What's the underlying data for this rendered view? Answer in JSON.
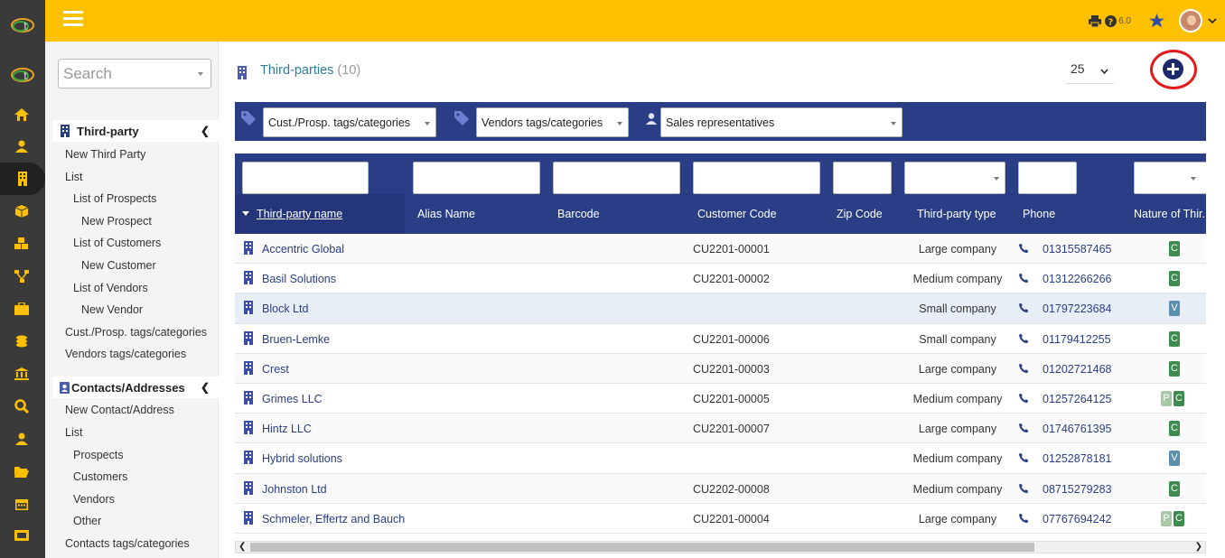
{
  "app": {
    "version": "6.0"
  },
  "sidebar_search": {
    "placeholder": "Search"
  },
  "menu": {
    "section1": {
      "title": "Third-party",
      "items": [
        "New Third Party",
        "List",
        "List of Prospects",
        "New Prospect",
        "List of Customers",
        "New Customer",
        "List of Vendors",
        "New Vendor",
        "Cust./Prosp. tags/categories",
        "Vendors tags/categories"
      ]
    },
    "section2": {
      "title": "Contacts/Addresses",
      "items": [
        "New Contact/Address",
        "List",
        "Prospects",
        "Customers",
        "Vendors",
        "Other",
        "Contacts tags/categories"
      ]
    }
  },
  "page": {
    "title": "Third-parties",
    "count": "(10)",
    "limit": "25"
  },
  "filters": {
    "cust": "Cust./Prosp. tags/categories",
    "vendors": "Vendors tags/categories",
    "sales": "Sales representatives"
  },
  "columns": [
    "Third-party name",
    "Alias Name",
    "Barcode",
    "Customer Code",
    "Zip Code",
    "Third-party type",
    "Phone",
    "Nature of Thir..."
  ],
  "rows": [
    {
      "name": "Accentric Global",
      "code": "CU2201-00001",
      "type": "Large company",
      "phone": "01315587465",
      "badges": [
        "C"
      ]
    },
    {
      "name": "Basil Solutions",
      "code": "CU2201-00002",
      "type": "Medium company",
      "phone": "01312266266",
      "badges": [
        "C"
      ]
    },
    {
      "name": "Block Ltd",
      "code": "",
      "type": "Small company",
      "phone": "01797223684",
      "badges": [
        "V"
      ]
    },
    {
      "name": "Bruen-Lemke",
      "code": "CU2201-00006",
      "type": "Small company",
      "phone": "01179412255",
      "badges": [
        "C"
      ]
    },
    {
      "name": "Crest",
      "code": "CU2201-00003",
      "type": "Large company",
      "phone": "01202721468",
      "badges": [
        "C"
      ]
    },
    {
      "name": "Grimes LLC",
      "code": "CU2201-00005",
      "type": "Medium company",
      "phone": "01257264125",
      "badges": [
        "P",
        "C"
      ]
    },
    {
      "name": "Hintz LLC",
      "code": "CU2201-00007",
      "type": "Large company",
      "phone": "01746761395",
      "badges": [
        "C"
      ]
    },
    {
      "name": "Hybrid solutions",
      "code": "",
      "type": "Medium company",
      "phone": "01252878181",
      "badges": [
        "V"
      ]
    },
    {
      "name": "Johnston Ltd",
      "code": "CU2202-00008",
      "type": "Medium company",
      "phone": "08715279283",
      "badges": [
        "C"
      ]
    },
    {
      "name": "Schmeler, Effertz and Bauch",
      "code": "CU2201-00004",
      "type": "Large company",
      "phone": "07767694242",
      "badges": [
        "P",
        "C"
      ]
    }
  ],
  "colors": {
    "accent": "#ffc000",
    "navy": "#2a3e85",
    "badge_C": "#3d8b4f",
    "badge_V": "#5b8fae",
    "badge_P": "#a8c8a8"
  }
}
